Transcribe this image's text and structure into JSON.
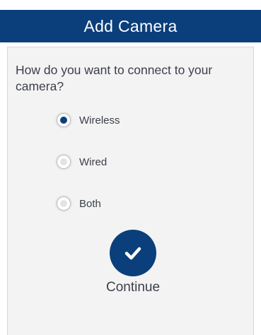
{
  "header": {
    "title": "Add Camera"
  },
  "question": "How do you want to connect to your camera?",
  "options": [
    {
      "label": "Wireless",
      "selected": true
    },
    {
      "label": "Wired",
      "selected": false
    },
    {
      "label": "Both",
      "selected": false
    }
  ],
  "continue": {
    "icon": "checkmark-icon",
    "label": "Continue"
  },
  "colors": {
    "accent": "#0b3f7b",
    "panel": "#f3f3f3",
    "text": "#3c3f4a"
  }
}
